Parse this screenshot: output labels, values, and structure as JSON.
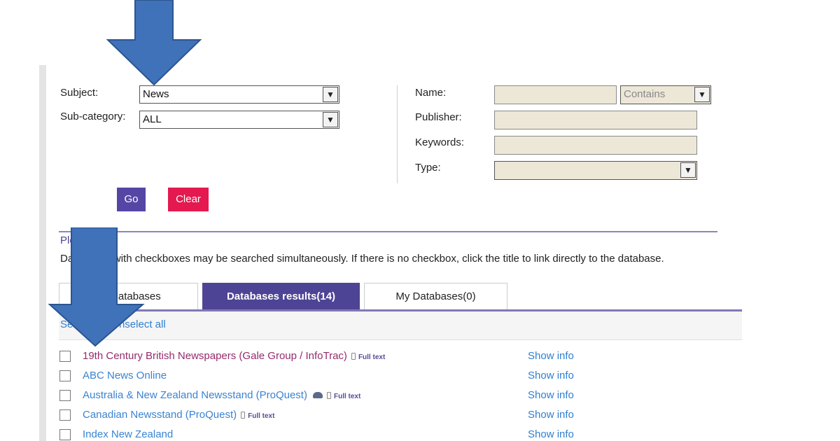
{
  "search": {
    "subject_label": "Subject:",
    "subject_value": "News",
    "subcategory_label": "Sub-category:",
    "subcategory_value": "ALL",
    "name_label": "Name:",
    "name_value": "",
    "name_match": "Contains",
    "publisher_label": "Publisher:",
    "publisher_value": "",
    "keywords_label": "Keywords:",
    "keywords_value": "",
    "type_label": "Type:",
    "type_value": "",
    "go_label": "Go",
    "clear_label": "Clear"
  },
  "note": {
    "heading": "Please note:",
    "text": "Databases with checkboxes may be searched simultaneously. If there is no checkbox, click the title to link directly to the database."
  },
  "tabs": [
    {
      "label": "All Databases",
      "active": false
    },
    {
      "label": "Databases results(14)",
      "active": true
    },
    {
      "label": "My Databases(0)",
      "active": false
    }
  ],
  "selection": {
    "select_all": "Select all",
    "separator": "|",
    "unselect_all": "Unselect all"
  },
  "results": [
    {
      "title": "19th Century British Newspapers (Gale Group / InfoTrac)",
      "fulltext": "Full text",
      "show_info": "Show info",
      "visited": true
    },
    {
      "title": "ABC News Online",
      "fulltext": "",
      "show_info": "Show info",
      "visited": false
    },
    {
      "title": "Australia & New Zealand Newsstand (ProQuest)",
      "fulltext": "Full text",
      "show_info": "Show info",
      "visited": false,
      "has_extra_icon": true
    },
    {
      "title": "Canadian Newsstand (ProQuest)",
      "fulltext": "Full text",
      "show_info": "Show info",
      "visited": false
    },
    {
      "title": "Index New Zealand",
      "fulltext": "",
      "show_info": "Show info",
      "visited": false
    }
  ],
  "colors": {
    "go_button": "#5546a6",
    "clear_button": "#e3194f",
    "active_tab": "#4e4495",
    "link": "#2f7fd0",
    "visited_link": "#962b6b",
    "annotation_arrow": "#3f72b8"
  }
}
